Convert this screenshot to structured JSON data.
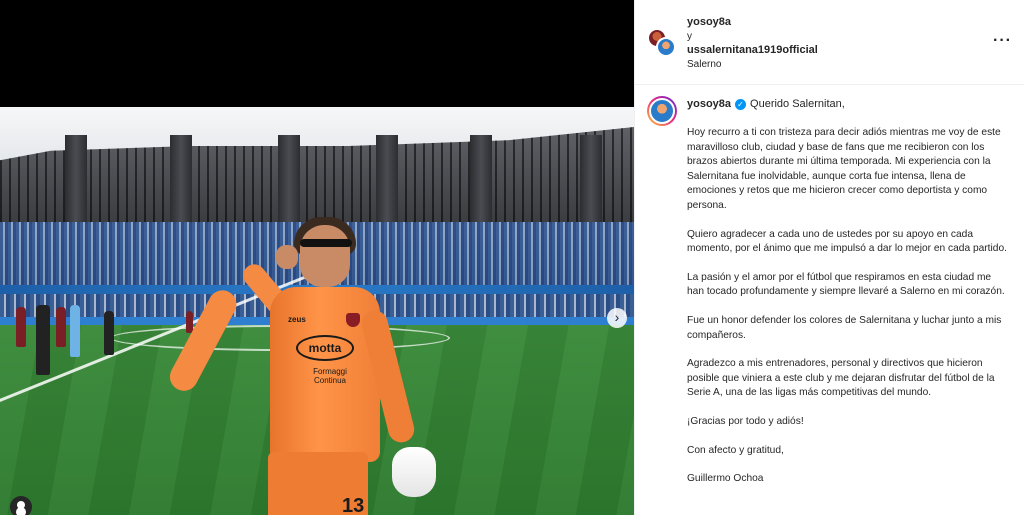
{
  "post": {
    "carousel_next": "›"
  },
  "header": {
    "user1": "yosoy8a",
    "and": "y",
    "user2": "ussalernitana1919official",
    "location": "Salerno",
    "more": "···"
  },
  "caption": {
    "username": "yosoy8a",
    "greeting": "Querido Salernitan,",
    "paragraphs": [
      "Hoy recurro a ti con tristeza para decir adiós mientras me voy de este maravilloso club, ciudad y base de fans que me recibieron con los brazos abiertos durante mi última temporada. Mi experiencia con la Salernitana fue inolvidable, aunque corta fue intensa, llena de emociones y retos que me hicieron crecer como deportista y como persona.",
      "Quiero agradecer a cada uno de ustedes por su apoyo en cada momento, por el ánimo que me impulsó a dar lo mejor en cada partido.",
      "La pasión y el amor por el fútbol que respiramos en esta ciudad me han tocado profundamente y siempre llevaré a Salerno en mi corazón.",
      "Fue un honor defender los colores de Salernitana y luchar junto a mis compañeros.",
      "Agradezco a mis entrenadores, personal y directivos que hicieron posible que viniera a este club y me dejaran disfrutar del fútbol de la Serie A, una de las ligas más competitivas del mundo.",
      "¡Gracias por todo y adiós!",
      "Con afecto y gratitud,",
      "Guillermo Ochoa"
    ]
  },
  "photo": {
    "sponsor": "motta",
    "sponsor_sub": "Formaggi Continua",
    "kit_brand": "zeus",
    "shirt_number": "13"
  },
  "colors": {
    "verified": "#0095f6",
    "kit": "#f58a42",
    "pitch": "#2d7a2e"
  }
}
